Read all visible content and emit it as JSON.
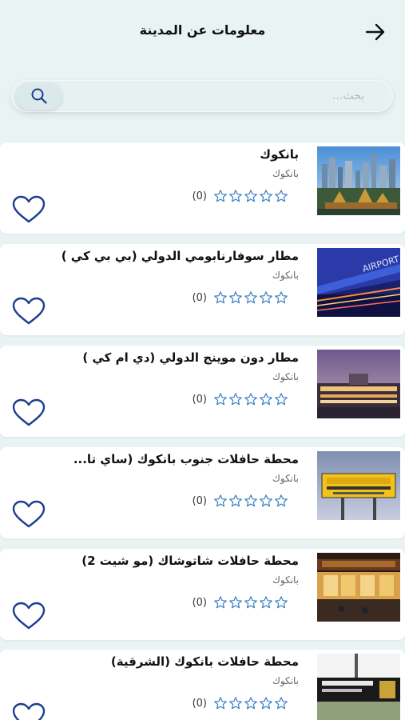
{
  "header": {
    "title": "معلومات عن المدينة",
    "back_icon": "arrow-right-icon"
  },
  "search": {
    "placeholder": "بحث...",
    "value": "",
    "icon": "search-icon"
  },
  "colors": {
    "accent": "#1c3f8f",
    "star": "#3b7fc4",
    "background": "#eaf3f4"
  },
  "places": [
    {
      "name": "بانكوك",
      "city": "بانكوك",
      "rating_count": "(0)",
      "stars": 0,
      "image": "bangkok-skyline"
    },
    {
      "name": "مطار سوفارنابومي الدولي (بي بي كي )",
      "city": "بانكوك",
      "rating_count": "(0)",
      "stars": 0,
      "image": "suvarnabhumi-airport"
    },
    {
      "name": "مطار دون موينج الدولي (دي ام كي )",
      "city": "بانكوك",
      "rating_count": "(0)",
      "stars": 0,
      "image": "don-mueang-airport"
    },
    {
      "name": "محطة حافلات جنوب بانكوك (ساي تا...",
      "city": "بانكوك",
      "rating_count": "(0)",
      "stars": 0,
      "image": "southern-bus-terminal-sign"
    },
    {
      "name": "محطة حافلات شاتوشاك (مو شيت 2)",
      "city": "بانكوك",
      "rating_count": "(0)",
      "stars": 0,
      "image": "mo-chit-bus-terminal"
    },
    {
      "name": "محطة حافلات بانكوك (الشرقية)",
      "city": "بانكوك",
      "rating_count": "(0)",
      "stars": 0,
      "image": "eastern-bus-terminal"
    }
  ]
}
